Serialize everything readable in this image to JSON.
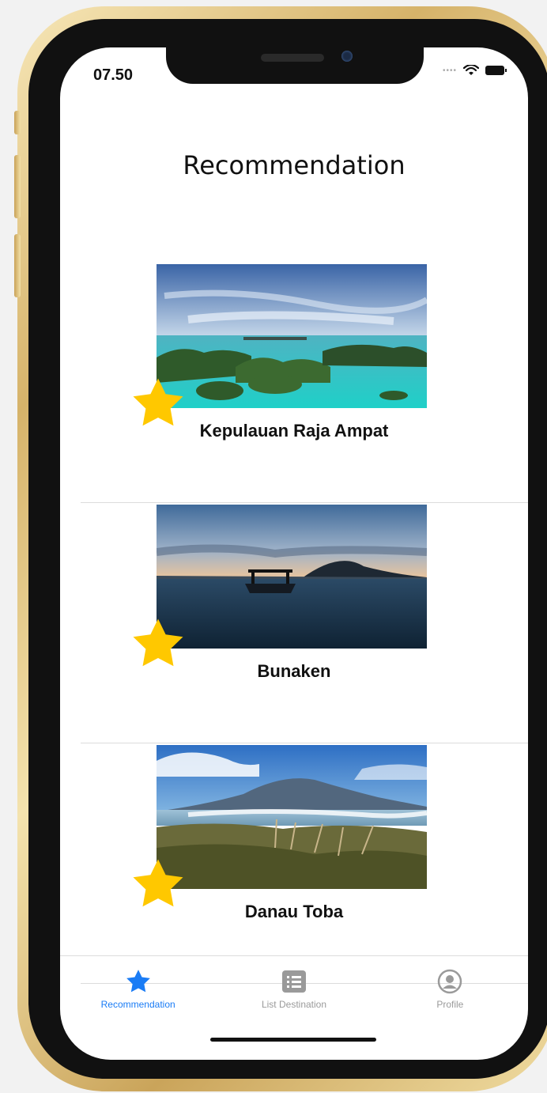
{
  "status_bar": {
    "time": "07.50"
  },
  "header": {
    "title": "Recommendation"
  },
  "destinations": [
    {
      "name": "Kepulauan Raja Ampat",
      "image": "raja-ampat-islands-photo",
      "favorite": true
    },
    {
      "name": "Bunaken",
      "image": "bunaken-sunset-boat-photo",
      "favorite": true
    },
    {
      "name": "Danau Toba",
      "image": "danau-toba-mountain-photo",
      "favorite": true
    }
  ],
  "tab_bar": {
    "tabs": [
      {
        "label": "Recommendation",
        "icon": "star-icon",
        "active": true
      },
      {
        "label": "List Destination",
        "icon": "list-icon",
        "active": false
      },
      {
        "label": "Profile",
        "icon": "person-circle-icon",
        "active": false
      }
    ]
  },
  "colors": {
    "accent": "#1a7cf5",
    "star": "#ffc800",
    "frame_gold": "#d6b36a"
  }
}
